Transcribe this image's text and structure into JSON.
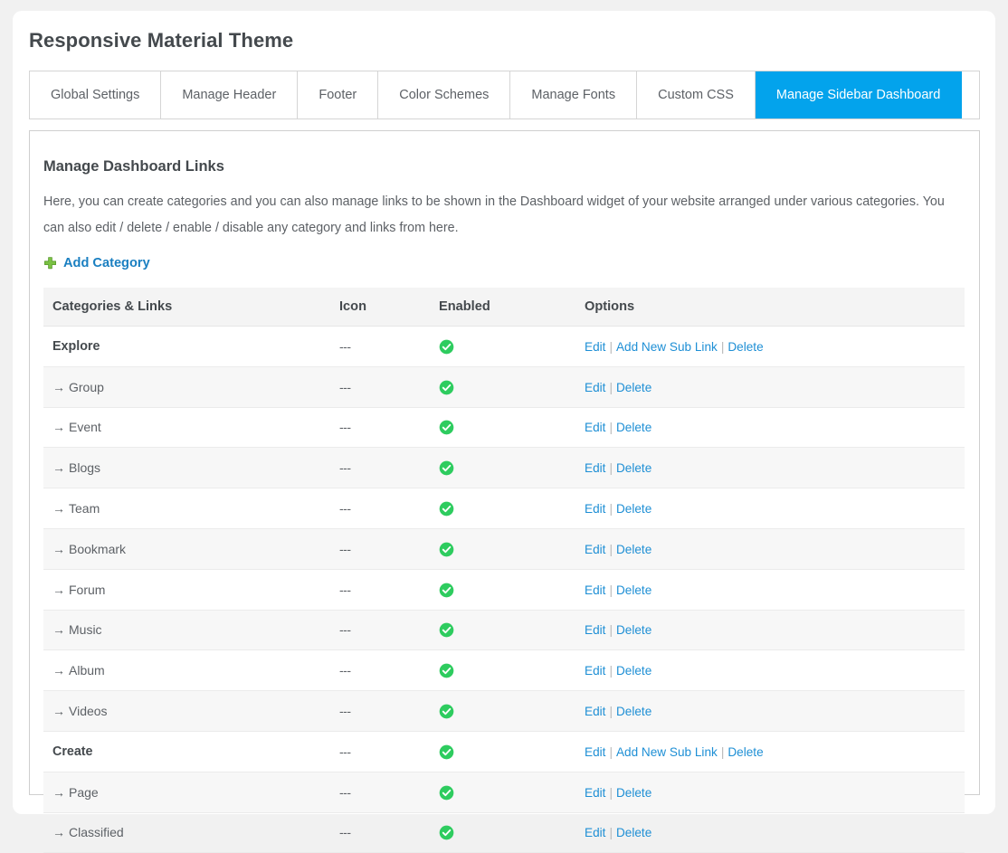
{
  "page": {
    "title": "Responsive Material Theme",
    "background_color": "#f1f1f1",
    "card_color": "#ffffff",
    "accent_color": "#03a3ec",
    "link_color": "#1e8fd5",
    "success_color": "#2ecc5f"
  },
  "tabs": [
    {
      "label": "Global Settings",
      "active": false
    },
    {
      "label": "Manage Header",
      "active": false
    },
    {
      "label": "Footer",
      "active": false
    },
    {
      "label": "Color Schemes",
      "active": false
    },
    {
      "label": "Manage Fonts",
      "active": false
    },
    {
      "label": "Custom CSS",
      "active": false
    },
    {
      "label": "Manage Sidebar Dashboard",
      "active": true
    }
  ],
  "panel": {
    "title": "Manage Dashboard Links",
    "description": "Here, you can create categories and you can also manage links to be shown in the Dashboard widget of your website arranged under various categories. You can also edit / delete / enable / disable any category and links from here.",
    "add_category_label": "Add Category",
    "add_category_icon": "plus-icon"
  },
  "table": {
    "headers": {
      "name": "Categories & Links",
      "icon": "Icon",
      "enabled": "Enabled",
      "options": "Options"
    },
    "icon_placeholder": "---",
    "enabled_icon": "check-circle-icon",
    "options": {
      "edit": "Edit",
      "add_sub_link": "Add New Sub Link",
      "delete": "Delete",
      "separator": "|"
    },
    "sub_arrow": "→",
    "rows": [
      {
        "name": "Explore",
        "type": "category",
        "icon": "---",
        "enabled": true,
        "options": [
          "Edit",
          "Add New Sub Link",
          "Delete"
        ]
      },
      {
        "name": "Group",
        "type": "sublink",
        "icon": "---",
        "enabled": true,
        "options": [
          "Edit",
          "Delete"
        ]
      },
      {
        "name": "Event",
        "type": "sublink",
        "icon": "---",
        "enabled": true,
        "options": [
          "Edit",
          "Delete"
        ]
      },
      {
        "name": "Blogs",
        "type": "sublink",
        "icon": "---",
        "enabled": true,
        "options": [
          "Edit",
          "Delete"
        ]
      },
      {
        "name": "Team",
        "type": "sublink",
        "icon": "---",
        "enabled": true,
        "options": [
          "Edit",
          "Delete"
        ]
      },
      {
        "name": "Bookmark",
        "type": "sublink",
        "icon": "---",
        "enabled": true,
        "options": [
          "Edit",
          "Delete"
        ]
      },
      {
        "name": "Forum",
        "type": "sublink",
        "icon": "---",
        "enabled": true,
        "options": [
          "Edit",
          "Delete"
        ]
      },
      {
        "name": "Music",
        "type": "sublink",
        "icon": "---",
        "enabled": true,
        "options": [
          "Edit",
          "Delete"
        ]
      },
      {
        "name": "Album",
        "type": "sublink",
        "icon": "---",
        "enabled": true,
        "options": [
          "Edit",
          "Delete"
        ]
      },
      {
        "name": "Videos",
        "type": "sublink",
        "icon": "---",
        "enabled": true,
        "options": [
          "Edit",
          "Delete"
        ]
      },
      {
        "name": "Create",
        "type": "category",
        "icon": "---",
        "enabled": true,
        "options": [
          "Edit",
          "Add New Sub Link",
          "Delete"
        ]
      },
      {
        "name": "Page",
        "type": "sublink",
        "icon": "---",
        "enabled": true,
        "options": [
          "Edit",
          "Delete"
        ]
      },
      {
        "name": "Classified",
        "type": "sublink",
        "icon": "---",
        "enabled": true,
        "options": [
          "Edit",
          "Delete"
        ]
      }
    ]
  }
}
